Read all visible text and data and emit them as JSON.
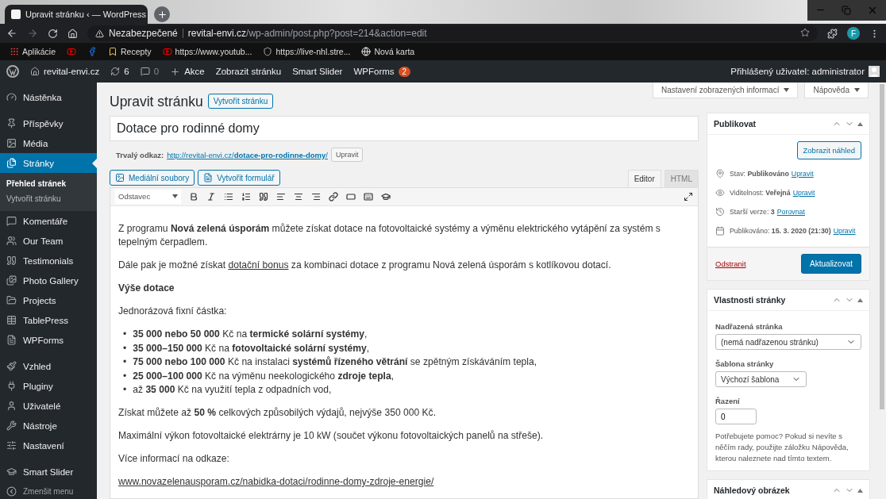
{
  "browser": {
    "tabs": [
      {
        "title": "Upravit stránku ‹ — WordPress",
        "selected": true
      }
    ],
    "address": {
      "security": "Nezabezpečené",
      "host": "revital-envi.cz",
      "path": "/wp-admin/post.php?post=214&action=edit"
    },
    "profile_initial": "F",
    "bookmarks": [
      {
        "kind": "apps",
        "label": "Aplikácie"
      },
      {
        "kind": "youtube"
      },
      {
        "kind": "facebook"
      },
      {
        "kind": "folder",
        "label": "Recepty"
      },
      {
        "kind": "youtube",
        "label": "https://www.youtub..."
      },
      {
        "kind": "hockey",
        "label": "https://live-nhl.stre..."
      },
      {
        "kind": "globe",
        "label": "Nová karta"
      }
    ]
  },
  "admin_bar": {
    "site": "revital-envi.cz",
    "updates": "6",
    "comments": "0",
    "new": "Akce",
    "links": [
      "Zobrazit stránku",
      "Smart Slider"
    ],
    "forms": {
      "label": "WPForms",
      "badge": "2"
    },
    "user": "Přihlášený uživatel: administrator"
  },
  "sidebar": {
    "groups": [
      [
        {
          "kind": "dashboard",
          "label": "Nástěnka",
          "selected": false
        }
      ],
      [
        {
          "kind": "pin",
          "label": "Příspěvky",
          "selected": false
        },
        {
          "kind": "media",
          "label": "Média",
          "selected": false
        },
        {
          "kind": "pages",
          "label": "Stránky",
          "selected": true,
          "children": [
            {
              "label": "Přehled stránek",
              "selected": true
            },
            {
              "label": "Vytvořit stránku",
              "selected": false
            }
          ]
        },
        {
          "kind": "comments",
          "label": "Komentáře",
          "selected": false
        },
        {
          "kind": "team",
          "label": "Our Team",
          "selected": false
        },
        {
          "kind": "quote",
          "label": "Testimonials",
          "selected": false
        },
        {
          "kind": "gallery",
          "label": "Photo Gallery",
          "selected": false
        },
        {
          "kind": "folder",
          "label": "Projects",
          "selected": false
        },
        {
          "kind": "table",
          "label": "TablePress",
          "selected": false
        },
        {
          "kind": "form",
          "label": "WPForms",
          "selected": false
        }
      ],
      [
        {
          "kind": "brush",
          "label": "Vzhled",
          "selected": false
        },
        {
          "kind": "plug",
          "label": "Pluginy",
          "selected": false
        },
        {
          "kind": "user",
          "label": "Uživatelé",
          "selected": false
        },
        {
          "kind": "wrench",
          "label": "Nástroje",
          "selected": false
        },
        {
          "kind": "settings",
          "label": "Nastavení",
          "selected": false
        }
      ],
      [
        {
          "kind": "cap",
          "label": "Smart Slider",
          "selected": false
        },
        {
          "kind": "collapse",
          "label": "Zmenšit menu",
          "selected": false
        }
      ]
    ]
  },
  "screen_tabs": [
    "Nastavení zobrazených informací",
    "Nápověda"
  ],
  "heading": {
    "title": "Upravit stránku",
    "action": "Vytvořit stránku"
  },
  "post_title": "Dotace pro rodinné domy",
  "permalink": {
    "label": "Trvalý odkaz:",
    "url": "http://revital-envi.cz/**dotace-pro-rodinne-domy**/",
    "button": "Upravit"
  },
  "media_buttons": [
    {
      "kind": "media",
      "label": "Mediální soubory"
    },
    {
      "kind": "form",
      "label": "Vytvořit formulář"
    }
  ],
  "editor_tabs": [
    {
      "label": "Editor",
      "selected": true
    },
    {
      "label": "HTML",
      "selected": false
    }
  ],
  "format": "Odstavec",
  "toolbar": [
    {
      "kind": "bold"
    },
    {
      "kind": "italic"
    },
    {
      "kind": "bullets"
    },
    {
      "kind": "numbers"
    },
    {
      "kind": "quote"
    },
    {
      "kind": "left"
    },
    {
      "kind": "center"
    },
    {
      "kind": "right"
    },
    {
      "kind": "link"
    },
    {
      "kind": "more"
    },
    {
      "kind": "kitchen"
    },
    {
      "kind": "cap"
    }
  ],
  "content": [
    {
      "kind": "paragraph",
      "parts": [
        {
          "text": "Z programu **Nová zelená úsporám** můžete získat dotace na fotovoltaické systémy a výměnu elektrického vytápění za systém s tepelným čerpadlem."
        }
      ]
    },
    {
      "kind": "paragraph",
      "parts": [
        {
          "text": "Dále pak je možné získat "
        },
        {
          "link": "dotační bonus"
        },
        {
          "text": " za kombinaci dotace z programu Nová zelená úsporám s kotlíkovou dotací."
        }
      ]
    },
    {
      "kind": "heading",
      "text": "Výše dotace"
    },
    {
      "kind": "paragraph",
      "parts": [
        {
          "text": "Jednorázová fixní částka:"
        }
      ]
    },
    {
      "kind": "list",
      "marker": "•",
      "items": [
        "**35 000 nebo 50 000** Kč na **termické solární systémy**,",
        "**35 000–150 000** Kč na **fotovoltaické solární systémy**,",
        "**75 000 nebo 100 000** Kč na instalaci **systémů řízeného větrání** se zpětným získáváním tepla,",
        "**25 000–100 000** Kč na výměnu neekologického **zdroje tepla**,",
        "až **35 000** Kč na využití tepla z odpadních vod,"
      ]
    },
    {
      "kind": "paragraph",
      "parts": [
        {
          "text": "Získat můžete až **50 %** celkových způsobilých výdajů, nejvýše 350 000 Kč."
        }
      ]
    },
    {
      "kind": "paragraph",
      "parts": [
        {
          "text": "Maximální výkon fotovoltaické elektrárny je 10 kW (součet výkonu fotovoltaických panelů na střeše)."
        }
      ]
    },
    {
      "kind": "paragraph",
      "parts": [
        {
          "text": "Více informací na odkaze:"
        }
      ]
    },
    {
      "kind": "paragraph",
      "parts": [
        {
          "link": "www.novazelenausporam.cz/nabidka-dotaci/rodinne-domy-zdroje-energie/"
        }
      ]
    }
  ],
  "publish": {
    "title": "Publikovat",
    "preview": "Zobrazit náhled",
    "rows": [
      {
        "kind": "status",
        "label": "Stav:",
        "value": "Publikováno",
        "link": "Upravit"
      },
      {
        "kind": "visibility",
        "label": "Viditelnost:",
        "value": "Veřejná",
        "link": "Upravit"
      },
      {
        "kind": "revisions",
        "label": "Starší verze:",
        "value": "3",
        "link": "Porovnat"
      },
      {
        "kind": "date",
        "label": "Publikováno:",
        "value": "15. 3. 2020 (21:30)",
        "link": "Upravit"
      }
    ],
    "delete": "Odstranit",
    "update": "Aktualizovat"
  },
  "attributes": {
    "title": "Vlastnosti stránky",
    "parent_label": "Nadřazená stránka",
    "parent": "(nemá nadřazenou stránku)",
    "template_label": "Šablona stránky",
    "template": "Výchozí šablona",
    "order_label": "Řazení",
    "order": "0",
    "help": "Potřebujete pomoc? Pokud si nevíte s něčím rady, použijte záložku Nápověda, kterou naleznete nad tímto textem."
  },
  "thumbnail": {
    "title": "Náhledový obrázek"
  }
}
